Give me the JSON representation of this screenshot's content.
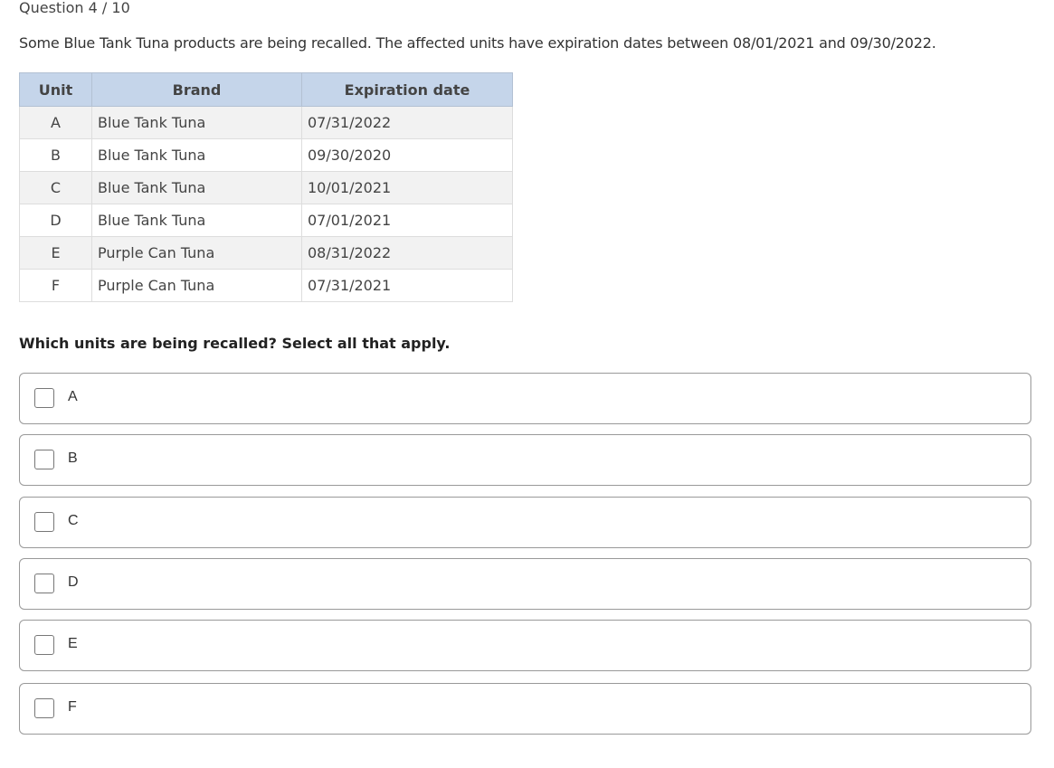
{
  "question_counter": "Question 4 / 10",
  "prompt": "Some Blue Tank Tuna products are being recalled. The affected units have expiration dates between 08/01/2021 and 09/30/2022.",
  "table": {
    "headers": [
      "Unit",
      "Brand",
      "Expiration date"
    ],
    "rows": [
      [
        "A",
        "Blue Tank Tuna",
        "07/31/2022"
      ],
      [
        "B",
        "Blue Tank Tuna",
        "09/30/2020"
      ],
      [
        "C",
        "Blue Tank Tuna",
        "10/01/2021"
      ],
      [
        "D",
        "Blue Tank Tuna",
        "07/01/2021"
      ],
      [
        "E",
        "Purple Can Tuna",
        "08/31/2022"
      ],
      [
        "F",
        "Purple Can Tuna",
        "07/31/2021"
      ]
    ]
  },
  "question": "Which units are being recalled? Select all that apply.",
  "options": [
    {
      "label": "A",
      "checked": false
    },
    {
      "label": "B",
      "checked": false
    },
    {
      "label": "C",
      "checked": false
    },
    {
      "label": "D",
      "checked": false
    },
    {
      "label": "E",
      "checked": false
    },
    {
      "label": "F",
      "checked": false
    }
  ]
}
